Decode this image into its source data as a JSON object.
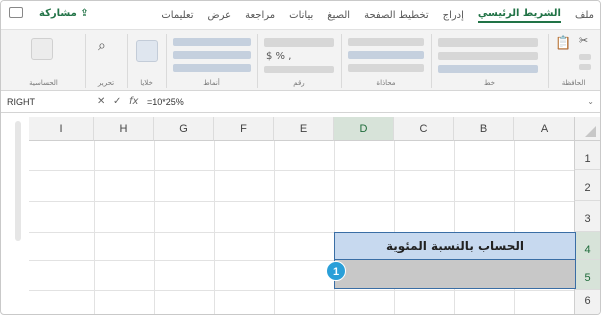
{
  "ribbon_tabs": [
    "ملف",
    "الشريط الرئيسي",
    "إدراج",
    "تخطيط الصفحة",
    "الصيغ",
    "بيانات",
    "مراجعة",
    "عرض",
    "تعليمات"
  ],
  "share_label": "مشاركة",
  "ribbon_groups": {
    "clipboard": "الحافظة",
    "font": "خط",
    "alignment": "محاذاة",
    "number": "رقم",
    "styles": "أنماط",
    "cells": "خلايا",
    "editing": "تحرير",
    "analysis": "الحساسية"
  },
  "formula_bar": {
    "name_box": "RIGHT",
    "cancel_icon": "✕",
    "enter_icon": "✓",
    "fx_label": "fx",
    "formula": "=10*25%"
  },
  "columns": [
    "A",
    "B",
    "C",
    "D",
    "E",
    "F",
    "G",
    "H",
    "I"
  ],
  "rows": [
    "1",
    "2",
    "3",
    "4",
    "5",
    "6"
  ],
  "cells": {
    "title": "الحساب بالنسبة المئوية"
  },
  "callout": "1",
  "colors": {
    "accent_green": "#217346",
    "title_fill": "#c7d9ef",
    "selected_fill": "#c8c8c8",
    "selection_border": "#3a6ea5",
    "callout": "#2a9fd8"
  }
}
